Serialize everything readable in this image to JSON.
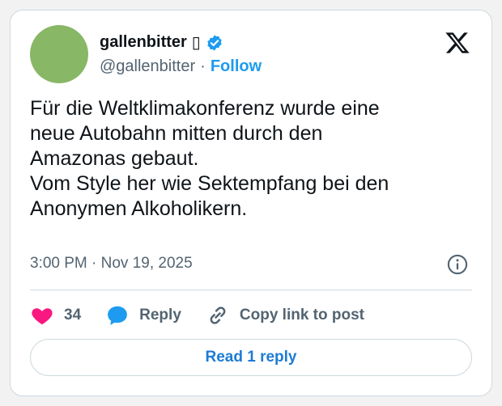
{
  "author": {
    "display_name": "gallenbitter",
    "name_emoji": "▯",
    "handle": "@gallenbitter",
    "separator": "·",
    "follow_label": "Follow",
    "avatar_color": "#88b765"
  },
  "tweet": {
    "text": "Für die Weltklimakonferenz wurde eine\nneue Autobahn mitten durch den\nAmazonas gebaut.\nVom Style her wie Sektempfang bei den\nAnonymen Alkoholikern.",
    "timestamp": "3:00 PM · Nov 19, 2025"
  },
  "actions": {
    "like_count": "34",
    "reply_label": "Reply",
    "copy_link_label": "Copy link to post"
  },
  "read_replies_label": "Read 1 reply",
  "colors": {
    "accent": "#1d9bf0",
    "like": "#f91880",
    "verified": "#1d9bf0"
  },
  "icons": [
    "verified-badge-icon",
    "x-logo-icon",
    "info-icon",
    "heart-icon",
    "reply-bubble-icon",
    "link-icon"
  ]
}
